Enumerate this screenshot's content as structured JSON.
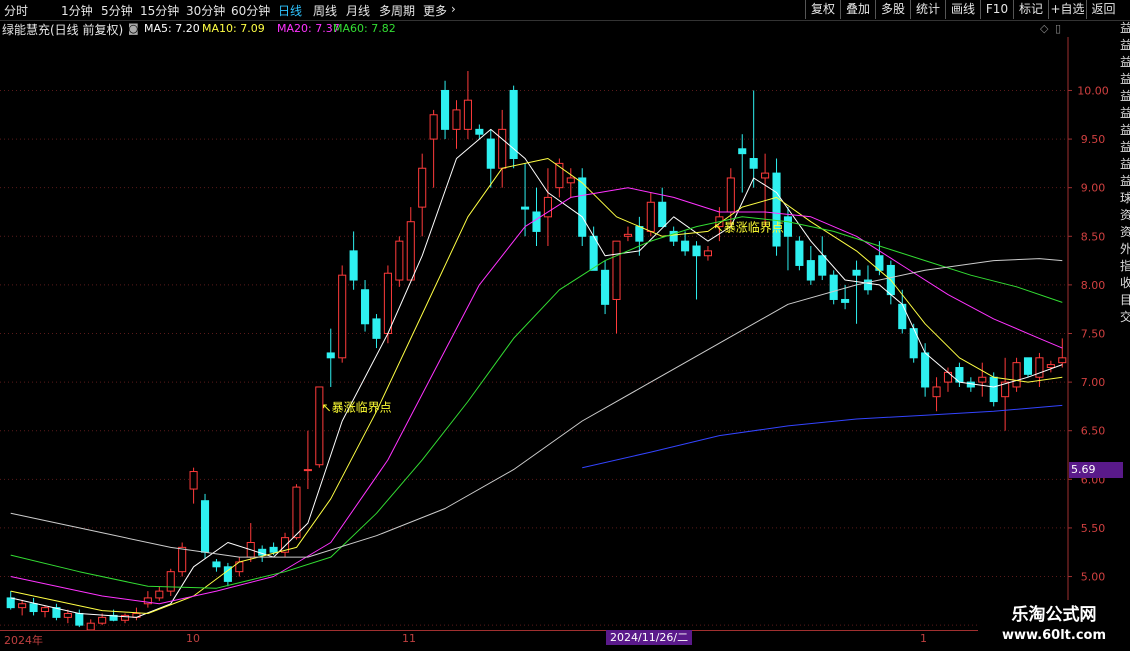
{
  "toolbar": {
    "periods": [
      "分时",
      "1分钟",
      "5分钟",
      "15分钟",
      "30分钟",
      "60分钟",
      "日线",
      "周线",
      "月线",
      "多周期",
      "更多"
    ],
    "active_period": "日线",
    "right_buttons": [
      "复权",
      "叠加",
      "多股",
      "统计",
      "画线",
      "F10",
      "标记",
      "+自选",
      "返回"
    ]
  },
  "info": {
    "stock_title": "绿能慧充(日线 前复权)",
    "ma5": "MA5: 7.20",
    "ma10": "MA10: 7.09",
    "ma20": "MA20: 7.37",
    "ma60": "MA60: 7.82"
  },
  "colors": {
    "up": "#ff3b3b",
    "down": "#2ef0f0",
    "ma5": "#ffffff",
    "ma10": "#ffff44",
    "ma20": "#ff33ff",
    "ma60": "#33dd33",
    "ma120": "#cccccc",
    "ma250": "#3344ff",
    "annotation": "#ffff33"
  },
  "annotations": [
    "↖暴涨临界点",
    "↖暴涨临界点"
  ],
  "date_axis": [
    "2024年",
    "10",
    "11",
    "1"
  ],
  "current_date": "2024/11/26/二",
  "price_box": "5.69",
  "brand": {
    "name": "乐淘公式网",
    "url": "www.60lt.com"
  },
  "chart_data": {
    "type": "candlestick",
    "y_ticks": [
      "10.00",
      "9.50",
      "9.00",
      "8.50",
      "8.00",
      "7.50",
      "7.00",
      "6.50",
      "6.00",
      "5.50",
      "5.00",
      "4.50"
    ],
    "ylim": [
      4.45,
      10.55
    ],
    "candles": [
      [
        4.78,
        4.85,
        4.66,
        4.68
      ],
      [
        4.68,
        4.76,
        4.6,
        4.72
      ],
      [
        4.72,
        4.78,
        4.6,
        4.64
      ],
      [
        4.64,
        4.7,
        4.58,
        4.68
      ],
      [
        4.68,
        4.72,
        4.55,
        4.58
      ],
      [
        4.58,
        4.66,
        4.52,
        4.62
      ],
      [
        4.62,
        4.66,
        4.48,
        4.5
      ],
      [
        4.45,
        4.56,
        4.4,
        4.52
      ],
      [
        4.52,
        4.62,
        4.5,
        4.58
      ],
      [
        4.6,
        4.66,
        4.54,
        4.55
      ],
      [
        4.55,
        4.62,
        4.52,
        4.6
      ],
      [
        4.58,
        4.68,
        4.55,
        4.62
      ],
      [
        4.72,
        4.85,
        4.68,
        4.78
      ],
      [
        4.78,
        4.9,
        4.75,
        4.85
      ],
      [
        4.85,
        5.08,
        4.8,
        5.05
      ],
      [
        5.05,
        5.35,
        5.0,
        5.3
      ],
      [
        5.9,
        6.12,
        5.75,
        6.08
      ],
      [
        5.78,
        5.85,
        5.18,
        5.25
      ],
      [
        5.15,
        5.18,
        5.05,
        5.1
      ],
      [
        5.1,
        5.14,
        4.9,
        4.95
      ],
      [
        5.05,
        5.2,
        5.0,
        5.15
      ],
      [
        5.2,
        5.55,
        5.15,
        5.35
      ],
      [
        5.28,
        5.32,
        5.15,
        5.22
      ],
      [
        5.3,
        5.35,
        5.22,
        5.25
      ],
      [
        5.25,
        5.45,
        5.2,
        5.4
      ],
      [
        5.4,
        5.95,
        5.38,
        5.92
      ],
      [
        6.1,
        6.5,
        5.9,
        6.1
      ],
      [
        6.15,
        6.95,
        6.12,
        6.95
      ],
      [
        7.3,
        7.55,
        6.95,
        7.25
      ],
      [
        7.25,
        8.2,
        7.2,
        8.1
      ],
      [
        8.35,
        8.55,
        7.95,
        8.05
      ],
      [
        7.95,
        8.05,
        7.52,
        7.6
      ],
      [
        7.65,
        7.7,
        7.35,
        7.45
      ],
      [
        7.5,
        8.2,
        7.4,
        8.12
      ],
      [
        8.05,
        8.5,
        7.98,
        8.45
      ],
      [
        8.05,
        8.8,
        8.05,
        8.65
      ],
      [
        8.8,
        9.35,
        8.5,
        9.2
      ],
      [
        9.5,
        9.8,
        9.0,
        9.75
      ],
      [
        10.0,
        10.1,
        9.5,
        9.6
      ],
      [
        9.6,
        9.9,
        9.4,
        9.8
      ],
      [
        9.6,
        10.2,
        9.5,
        9.9
      ],
      [
        9.6,
        9.65,
        9.5,
        9.55
      ],
      [
        9.5,
        9.6,
        9.0,
        9.2
      ],
      [
        9.2,
        9.8,
        9.0,
        9.6
      ],
      [
        10.0,
        10.05,
        9.2,
        9.3
      ],
      [
        8.8,
        9.25,
        8.5,
        8.78
      ],
      [
        8.75,
        9.0,
        8.4,
        8.55
      ],
      [
        8.7,
        9.2,
        8.4,
        8.9
      ],
      [
        9.0,
        9.3,
        8.9,
        9.25
      ],
      [
        9.05,
        9.2,
        8.9,
        9.1
      ],
      [
        9.1,
        9.2,
        8.4,
        8.5
      ],
      [
        8.5,
        8.6,
        8.15,
        8.15
      ],
      [
        8.15,
        8.25,
        7.7,
        7.8
      ],
      [
        7.85,
        8.45,
        7.5,
        8.45
      ],
      [
        8.5,
        8.6,
        8.45,
        8.52
      ],
      [
        8.6,
        8.7,
        8.3,
        8.45
      ],
      [
        8.55,
        8.95,
        8.5,
        8.85
      ],
      [
        8.85,
        9.0,
        8.65,
        8.6
      ],
      [
        8.55,
        8.6,
        8.4,
        8.45
      ],
      [
        8.45,
        8.55,
        8.3,
        8.35
      ],
      [
        8.4,
        8.45,
        7.85,
        8.3
      ],
      [
        8.3,
        8.4,
        8.25,
        8.35
      ],
      [
        8.6,
        8.8,
        8.45,
        8.7
      ],
      [
        8.75,
        9.2,
        8.6,
        9.1
      ],
      [
        9.4,
        9.55,
        8.95,
        9.35
      ],
      [
        9.3,
        10.0,
        9.0,
        9.2
      ],
      [
        9.1,
        9.35,
        8.6,
        9.15
      ],
      [
        9.15,
        9.3,
        8.3,
        8.4
      ],
      [
        8.7,
        8.8,
        8.15,
        8.5
      ],
      [
        8.45,
        8.5,
        8.15,
        8.2
      ],
      [
        8.25,
        8.4,
        8.0,
        8.05
      ],
      [
        8.3,
        8.5,
        8.05,
        8.1
      ],
      [
        8.1,
        8.15,
        7.8,
        7.85
      ],
      [
        7.85,
        8.0,
        7.75,
        7.82
      ],
      [
        8.15,
        8.25,
        7.6,
        8.1
      ],
      [
        8.05,
        8.2,
        7.9,
        7.95
      ],
      [
        8.3,
        8.45,
        8.1,
        8.15
      ],
      [
        8.2,
        8.25,
        7.8,
        7.9
      ],
      [
        7.8,
        7.95,
        7.5,
        7.55
      ],
      [
        7.55,
        7.6,
        7.2,
        7.25
      ],
      [
        7.3,
        7.4,
        6.85,
        6.95
      ],
      [
        6.85,
        7.05,
        6.7,
        6.95
      ],
      [
        7.0,
        7.15,
        6.9,
        7.1
      ],
      [
        7.15,
        7.2,
        6.95,
        7.0
      ],
      [
        7.0,
        7.05,
        6.9,
        6.95
      ],
      [
        7.0,
        7.2,
        6.85,
        7.05
      ],
      [
        7.05,
        7.1,
        6.75,
        6.8
      ],
      [
        6.85,
        7.25,
        6.5,
        7.0
      ],
      [
        6.95,
        7.25,
        6.9,
        7.2
      ],
      [
        7.25,
        7.25,
        7.05,
        7.08
      ],
      [
        7.05,
        7.3,
        6.95,
        7.25
      ],
      [
        7.15,
        7.22,
        7.1,
        7.18
      ],
      [
        7.2,
        7.45,
        7.15,
        7.25
      ]
    ],
    "ma_lines": {
      "ma5": [
        [
          0,
          4.78
        ],
        [
          6,
          4.62
        ],
        [
          11,
          4.58
        ],
        [
          14,
          4.72
        ],
        [
          16,
          5.1
        ],
        [
          19,
          5.35
        ],
        [
          23,
          5.2
        ],
        [
          26,
          5.55
        ],
        [
          29,
          6.6
        ],
        [
          33,
          7.5
        ],
        [
          36,
          8.3
        ],
        [
          39,
          9.3
        ],
        [
          42,
          9.6
        ],
        [
          45,
          9.3
        ],
        [
          47,
          8.95
        ],
        [
          50,
          8.7
        ],
        [
          52,
          8.3
        ],
        [
          55,
          8.35
        ],
        [
          58,
          8.7
        ],
        [
          61,
          8.45
        ],
        [
          63,
          8.6
        ],
        [
          65,
          9.1
        ],
        [
          67,
          8.95
        ],
        [
          70,
          8.45
        ],
        [
          73,
          8.05
        ],
        [
          76,
          8.0
        ],
        [
          78,
          7.8
        ],
        [
          80,
          7.3
        ],
        [
          83,
          7.0
        ],
        [
          86,
          6.95
        ],
        [
          89,
          7.05
        ],
        [
          92,
          7.18
        ]
      ],
      "ma10": [
        [
          0,
          4.85
        ],
        [
          8,
          4.65
        ],
        [
          12,
          4.62
        ],
        [
          16,
          4.8
        ],
        [
          20,
          5.15
        ],
        [
          25,
          5.3
        ],
        [
          28,
          5.8
        ],
        [
          32,
          6.7
        ],
        [
          36,
          7.7
        ],
        [
          40,
          8.7
        ],
        [
          43,
          9.2
        ],
        [
          47,
          9.3
        ],
        [
          50,
          9.05
        ],
        [
          53,
          8.7
        ],
        [
          57,
          8.5
        ],
        [
          61,
          8.55
        ],
        [
          64,
          8.8
        ],
        [
          67,
          8.9
        ],
        [
          70,
          8.65
        ],
        [
          74,
          8.35
        ],
        [
          77,
          8.05
        ],
        [
          80,
          7.6
        ],
        [
          83,
          7.25
        ],
        [
          86,
          7.05
        ],
        [
          89,
          7.0
        ],
        [
          92,
          7.05
        ]
      ],
      "ma20": [
        [
          0,
          5.0
        ],
        [
          8,
          4.8
        ],
        [
          13,
          4.72
        ],
        [
          18,
          4.85
        ],
        [
          23,
          5.0
        ],
        [
          28,
          5.35
        ],
        [
          33,
          6.2
        ],
        [
          37,
          7.1
        ],
        [
          41,
          8.0
        ],
        [
          45,
          8.6
        ],
        [
          49,
          8.9
        ],
        [
          54,
          9.0
        ],
        [
          58,
          8.9
        ],
        [
          62,
          8.75
        ],
        [
          66,
          8.75
        ],
        [
          70,
          8.7
        ],
        [
          74,
          8.5
        ],
        [
          78,
          8.2
        ],
        [
          82,
          7.9
        ],
        [
          86,
          7.65
        ],
        [
          90,
          7.45
        ],
        [
          92,
          7.35
        ]
      ],
      "ma60": [
        [
          0,
          5.22
        ],
        [
          6,
          5.05
        ],
        [
          12,
          4.9
        ],
        [
          18,
          4.88
        ],
        [
          24,
          5.05
        ],
        [
          28,
          5.2
        ],
        [
          32,
          5.65
        ],
        [
          36,
          6.2
        ],
        [
          40,
          6.8
        ],
        [
          44,
          7.45
        ],
        [
          48,
          7.95
        ],
        [
          52,
          8.25
        ],
        [
          56,
          8.45
        ],
        [
          60,
          8.6
        ],
        [
          64,
          8.7
        ],
        [
          68,
          8.65
        ],
        [
          72,
          8.55
        ],
        [
          76,
          8.4
        ],
        [
          80,
          8.25
        ],
        [
          84,
          8.1
        ],
        [
          88,
          7.98
        ],
        [
          92,
          7.82
        ]
      ],
      "ma120": [
        [
          0,
          5.65
        ],
        [
          8,
          5.45
        ],
        [
          14,
          5.3
        ],
        [
          20,
          5.2
        ],
        [
          26,
          5.2
        ],
        [
          32,
          5.42
        ],
        [
          38,
          5.7
        ],
        [
          44,
          6.1
        ],
        [
          50,
          6.6
        ],
        [
          56,
          7.0
        ],
        [
          62,
          7.4
        ],
        [
          68,
          7.8
        ],
        [
          74,
          8.0
        ],
        [
          80,
          8.15
        ],
        [
          86,
          8.25
        ],
        [
          90,
          8.27
        ],
        [
          92,
          8.25
        ]
      ],
      "ma250": [
        [
          50,
          6.12
        ],
        [
          56,
          6.28
        ],
        [
          62,
          6.45
        ],
        [
          68,
          6.55
        ],
        [
          74,
          6.62
        ],
        [
          80,
          6.66
        ],
        [
          86,
          6.7
        ],
        [
          92,
          6.76
        ]
      ]
    }
  }
}
